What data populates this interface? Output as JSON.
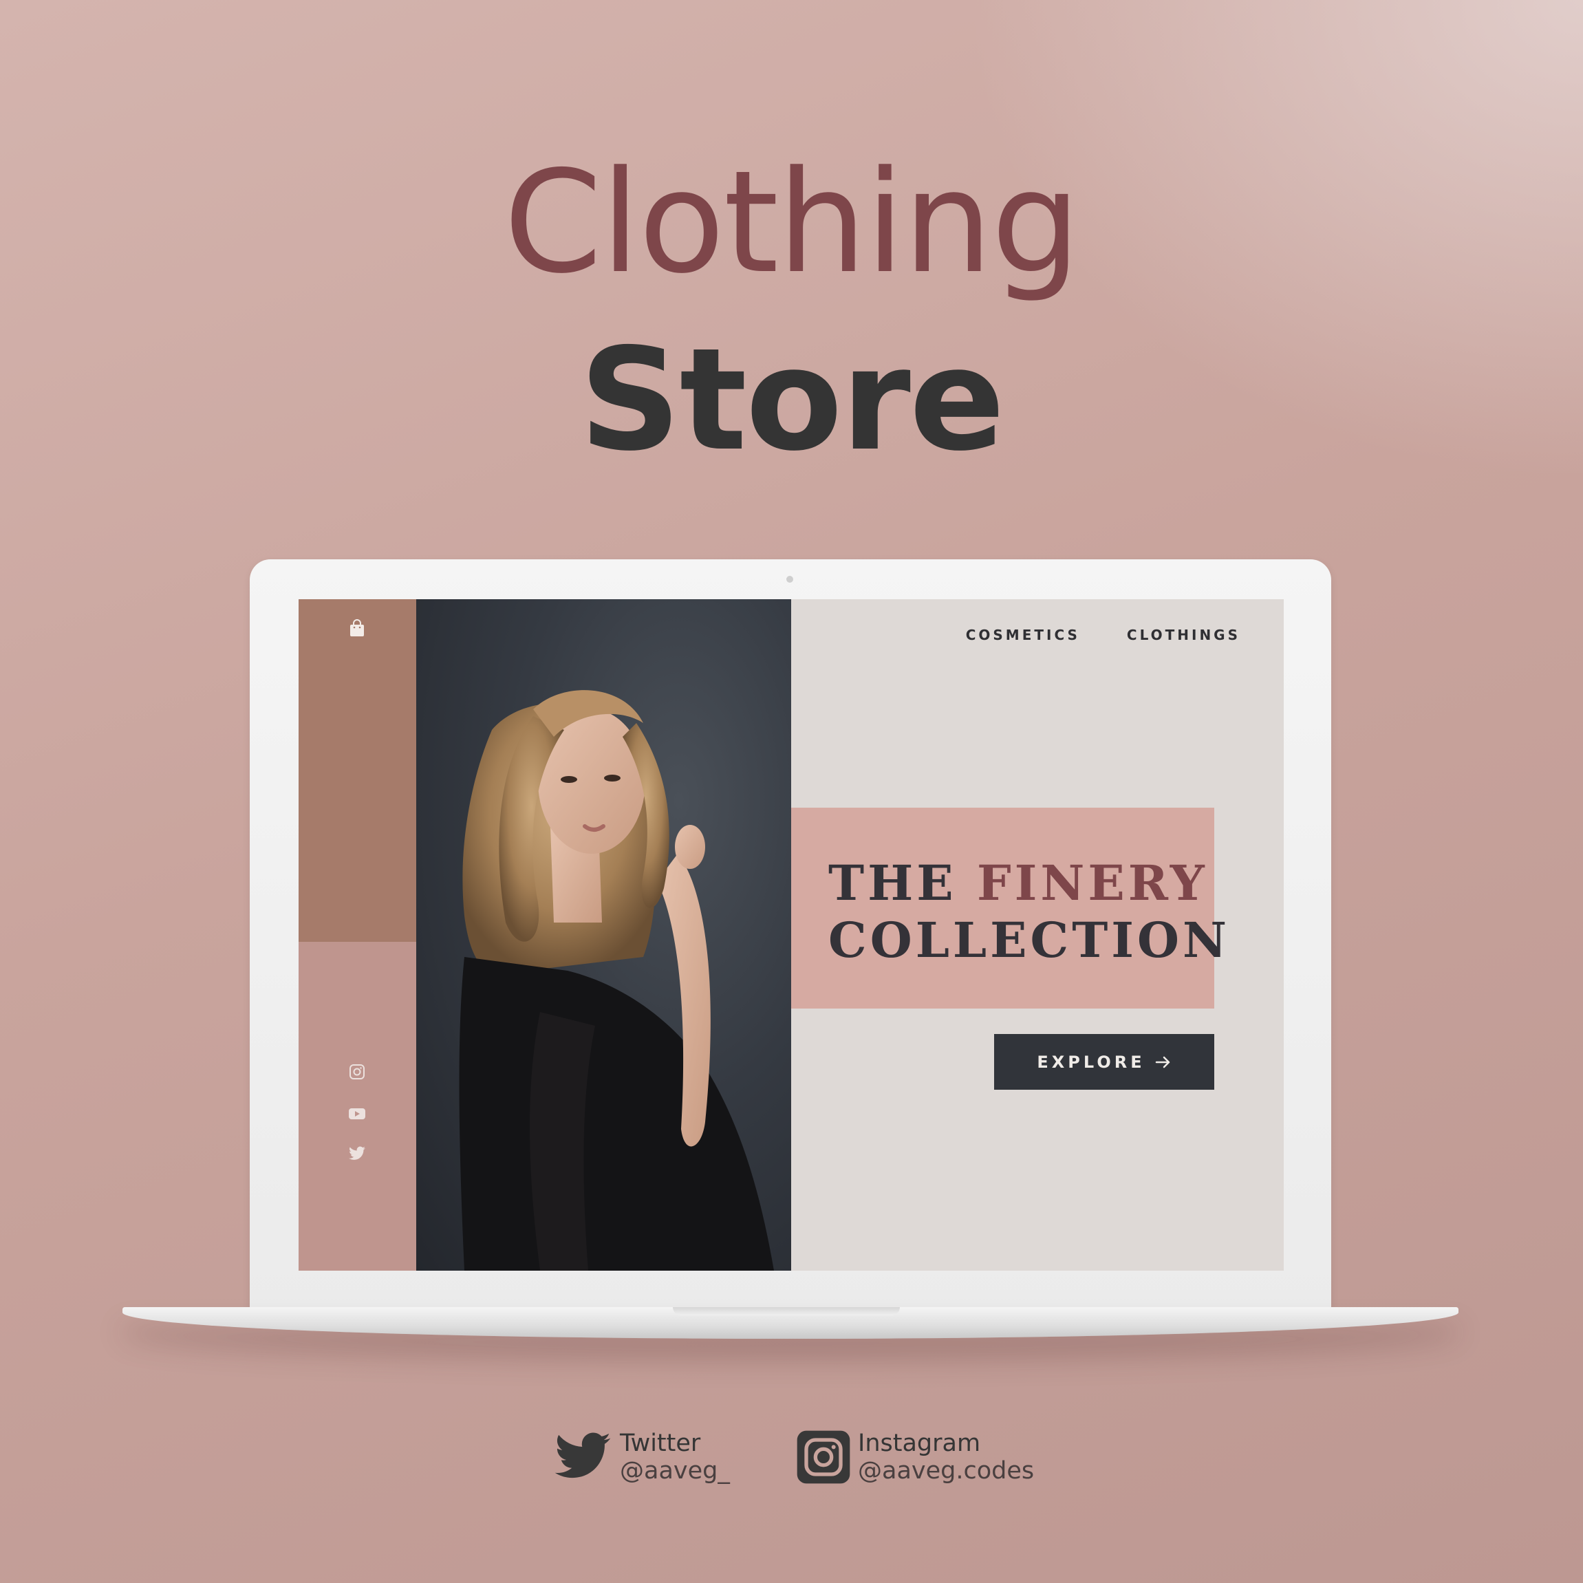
{
  "poster": {
    "title_line1": "Clothing",
    "title_line2": "Store"
  },
  "site": {
    "nav": [
      {
        "label": "COSMETICS"
      },
      {
        "label": "CLOTHINGS"
      }
    ],
    "hero": {
      "line1_prefix": "THE ",
      "line1_accent": "FINERY",
      "line2": "COLLECTION"
    },
    "cta": {
      "label": "EXPLORE",
      "icon": "arrow-right-icon"
    },
    "sidebar_icons": [
      "shopping-bag-icon",
      "instagram-icon",
      "youtube-icon",
      "twitter-icon"
    ]
  },
  "socials": [
    {
      "platform": "Twitter",
      "handle": "@aaveg_",
      "icon": "twitter-icon"
    },
    {
      "platform": "Instagram",
      "handle": "@aaveg.codes",
      "icon": "instagram-icon"
    }
  ],
  "colors": {
    "background": "#c9a49d",
    "title_accent": "#7e464a",
    "title_dark": "#343434",
    "sidebar_top": "#a67b6a",
    "sidebar_bottom": "#bf958e",
    "promo_box": "#d6aaa2",
    "cta_bg": "#31343a",
    "content_bg": "#ded9d6"
  }
}
